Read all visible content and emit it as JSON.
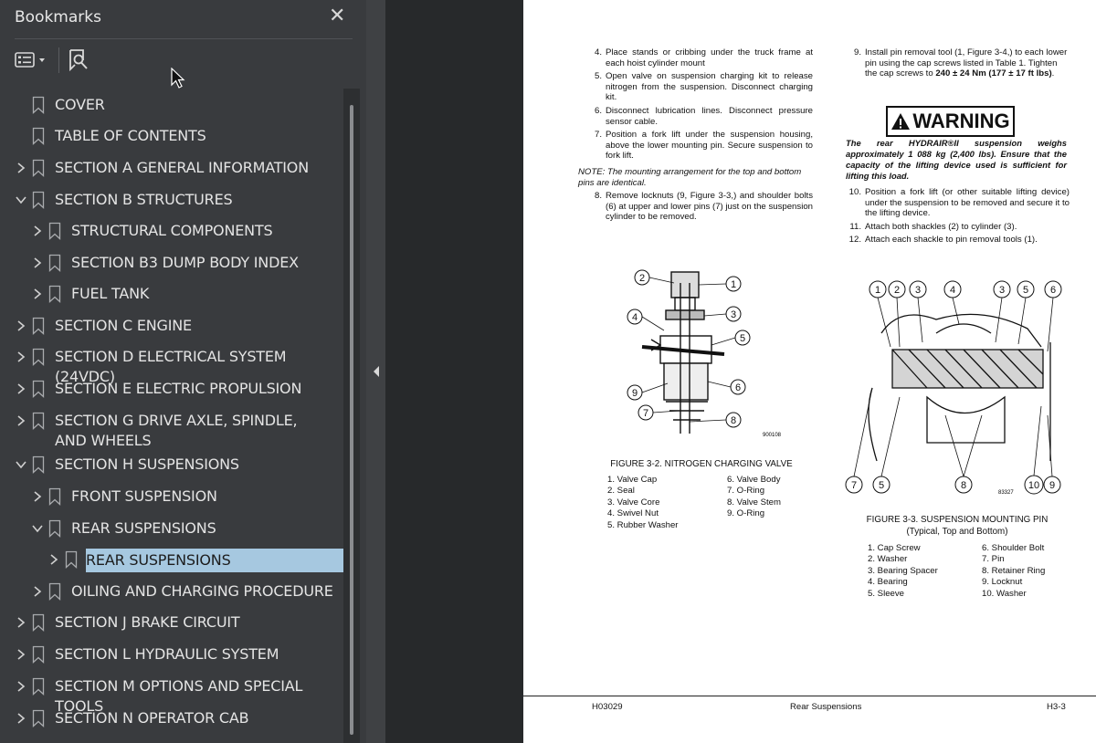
{
  "sidebar": {
    "title": "Bookmarks",
    "close_label": "✕",
    "items": [
      {
        "label": "COVER",
        "level": 0,
        "expander": "none"
      },
      {
        "label": "TABLE OF CONTENTS",
        "level": 0,
        "expander": "none"
      },
      {
        "label": "SECTION A GENERAL INFORMATION",
        "level": 0,
        "expander": "collapsed"
      },
      {
        "label": "SECTION B STRUCTURES",
        "level": 0,
        "expander": "expanded"
      },
      {
        "label": "STRUCTURAL COMPONENTS",
        "level": 1,
        "expander": "collapsed"
      },
      {
        "label": "SECTION B3 DUMP BODY INDEX",
        "level": 1,
        "expander": "collapsed"
      },
      {
        "label": "FUEL TANK",
        "level": 1,
        "expander": "collapsed"
      },
      {
        "label": "SECTION C ENGINE",
        "level": 0,
        "expander": "collapsed"
      },
      {
        "label": "SECTION D ELECTRICAL SYSTEM (24VDC)",
        "level": 0,
        "expander": "collapsed"
      },
      {
        "label": "SECTION E ELECTRIC PROPULSION",
        "level": 0,
        "expander": "collapsed"
      },
      {
        "label": "SECTION G DRIVE AXLE, SPINDLE, AND WHEELS",
        "level": 0,
        "expander": "collapsed"
      },
      {
        "label": "SECTION H SUSPENSIONS",
        "level": 0,
        "expander": "expanded"
      },
      {
        "label": "FRONT SUSPENSION",
        "level": 1,
        "expander": "collapsed"
      },
      {
        "label": "REAR SUSPENSIONS",
        "level": 1,
        "expander": "expanded"
      },
      {
        "label": "REAR SUSPENSIONS",
        "level": 2,
        "expander": "collapsed",
        "selected": true
      },
      {
        "label": "OILING AND CHARGING PROCEDURE",
        "level": 1,
        "expander": "collapsed"
      },
      {
        "label": "SECTION J BRAKE CIRCUIT",
        "level": 0,
        "expander": "collapsed"
      },
      {
        "label": "SECTION L  HYDRAULIC SYSTEM",
        "level": 0,
        "expander": "collapsed"
      },
      {
        "label": "SECTION M OPTIONS AND SPECIAL TOOLS",
        "level": 0,
        "expander": "collapsed"
      },
      {
        "label": "SECTION N OPERATOR CAB",
        "level": 0,
        "expander": "collapsed"
      }
    ]
  },
  "page": {
    "left_steps": [
      {
        "n": "4.",
        "text": "Place stands or cribbing under the truck frame at each hoist cylinder mount"
      },
      {
        "n": "5.",
        "text": "Open valve on suspension charging kit to release nitrogen from the suspension. Disconnect charging kit."
      },
      {
        "n": "6.",
        "text": "Disconnect lubrication lines. Disconnect pressure sensor cable."
      },
      {
        "n": "7.",
        "text": "Position a fork lift under the suspension housing, above the lower mounting pin. Secure suspension to fork lift."
      }
    ],
    "note": "NOTE: The mounting arrangement for the top and bottom pins are identical.",
    "left_steps2": [
      {
        "n": "8.",
        "text": "Remove locknuts (9, Figure 3-3,) and shoulder bolts (6) at upper and lower pins (7) just on the suspension cylinder to be removed."
      }
    ],
    "right_step9": {
      "n": "9.",
      "text": "Install pin removal tool (1, Figure 3-4,) to each lower pin using the cap screws listed in Table 1. Tighten the cap screws to ",
      "bold": "240 ± 24 Nm (177 ± 17 ft lbs)",
      "end": "."
    },
    "warning_title": "WARNING",
    "warning_text": "The rear HYDRAIR®II suspension weighs approximately 1 088 kg (2,400 lbs). Ensure that the capacity of the lifting device used is sufficient for lifting this load.",
    "right_steps": [
      {
        "n": "10.",
        "text": "Position a fork lift (or other suitable lifting device) under the suspension to be removed and secure it to the lifting device."
      },
      {
        "n": "11.",
        "text": "Attach both shackles (2) to cylinder (3)."
      },
      {
        "n": "12.",
        "text": "Attach each shackle to pin removal tools (1)."
      }
    ],
    "fig2_code": "900108",
    "fig2_caption": "FIGURE 3-2. NITROGEN CHARGING VALVE",
    "fig2_legend_a": [
      "1. Valve Cap",
      "2. Seal",
      "3. Valve Core",
      "4. Swivel Nut",
      "5. Rubber Washer"
    ],
    "fig2_legend_b": [
      "6. Valve Body",
      "7. O-Ring",
      "8. Valve Stem",
      "9. O-Ring"
    ],
    "fig3_code": "83327",
    "fig3_caption": "FIGURE 3-3. SUSPENSION MOUNTING PIN",
    "fig3_subcaption": "(Typical, Top and Bottom)",
    "fig3_legend_a": [
      "1. Cap Screw",
      "2. Washer",
      "3. Bearing Spacer",
      "4. Bearing",
      "5. Sleeve"
    ],
    "fig3_legend_b": [
      "6. Shoulder Bolt",
      "7. Pin",
      "8. Retainer Ring",
      "9. Locknut",
      "10. Washer"
    ],
    "footer_left": "H03029",
    "footer_center": "Rear Suspensions",
    "footer_right": "H3-3"
  }
}
